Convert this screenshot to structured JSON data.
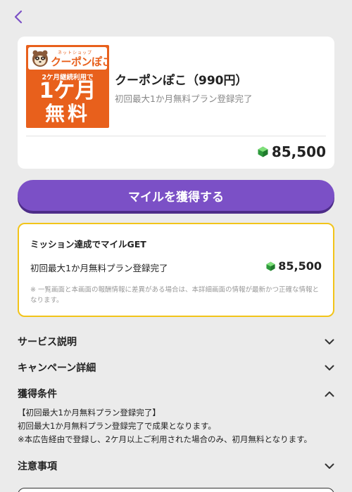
{
  "header": {
    "back_icon": "chevron-left-icon",
    "accent": "#7b50c6"
  },
  "offer": {
    "logo": {
      "small_text": "ネットショップ",
      "brand": "クーポンぽこ",
      "sub": "2ケ月継続利用で",
      "big_line1": "1ケ月",
      "big_line2": "無料",
      "bg_color": "#e8601c"
    },
    "title": "クーポンぽこ（990円）",
    "subtitle": "初回最大1か月無料プラン登録完了",
    "points": "85,500",
    "points_icon": "green-gem-icon"
  },
  "earn_button": {
    "label": "マイルを獲得する",
    "color": "#7b50c6"
  },
  "mission": {
    "title": "ミッション達成でマイルGET",
    "row_label": "初回最大1か月無料プラン登録完了",
    "row_points": "85,500",
    "note": "※ 一覧画面と本画面の報酬情報に差異がある場合は、本詳細画面の情報が最新かつ正確な情報となります。",
    "border_color": "#f2c419"
  },
  "sections": [
    {
      "label": "サービス説明",
      "expanded": false
    },
    {
      "label": "キャンペーン詳細",
      "expanded": false
    },
    {
      "label": "獲得条件",
      "expanded": true
    },
    {
      "label": "注意事項",
      "expanded": false
    }
  ],
  "conditions": {
    "line1": "【初回最大1か月無料プラン登録完了】",
    "line2": "初回最大1か月無料プラン登録完了で成果となります。",
    "line3": "※本広告経由で登録し、2ケ月以上ご利用された場合のみ、初月無料となります。"
  }
}
